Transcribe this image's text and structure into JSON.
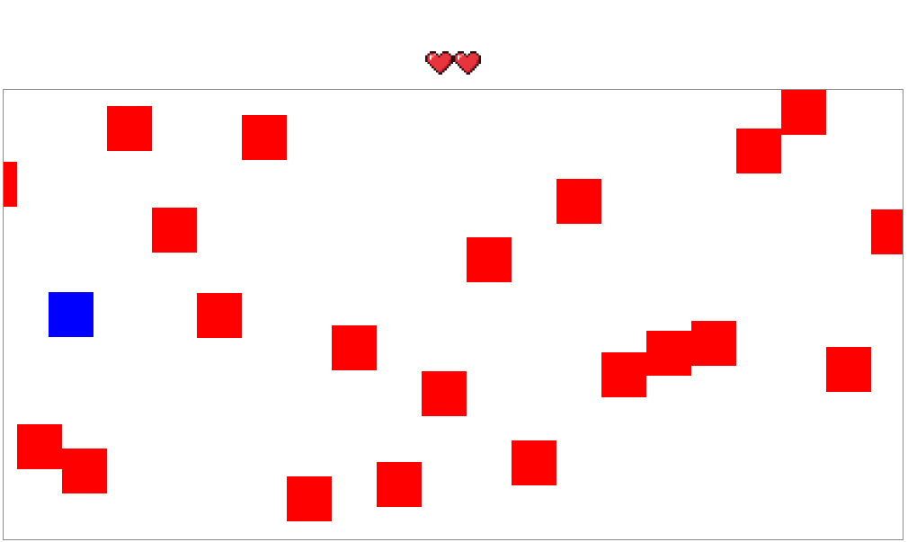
{
  "hud": {
    "lives": 2,
    "heart_icon": "heart-icon"
  },
  "colors": {
    "player": "#0000ff",
    "enemy": "#ff0000",
    "board_border": "#8a8a8a",
    "heart_fill": "#e8343c",
    "heart_outline": "#2b0f10"
  },
  "entities": {
    "player_count": 1,
    "enemy_count": 23
  }
}
